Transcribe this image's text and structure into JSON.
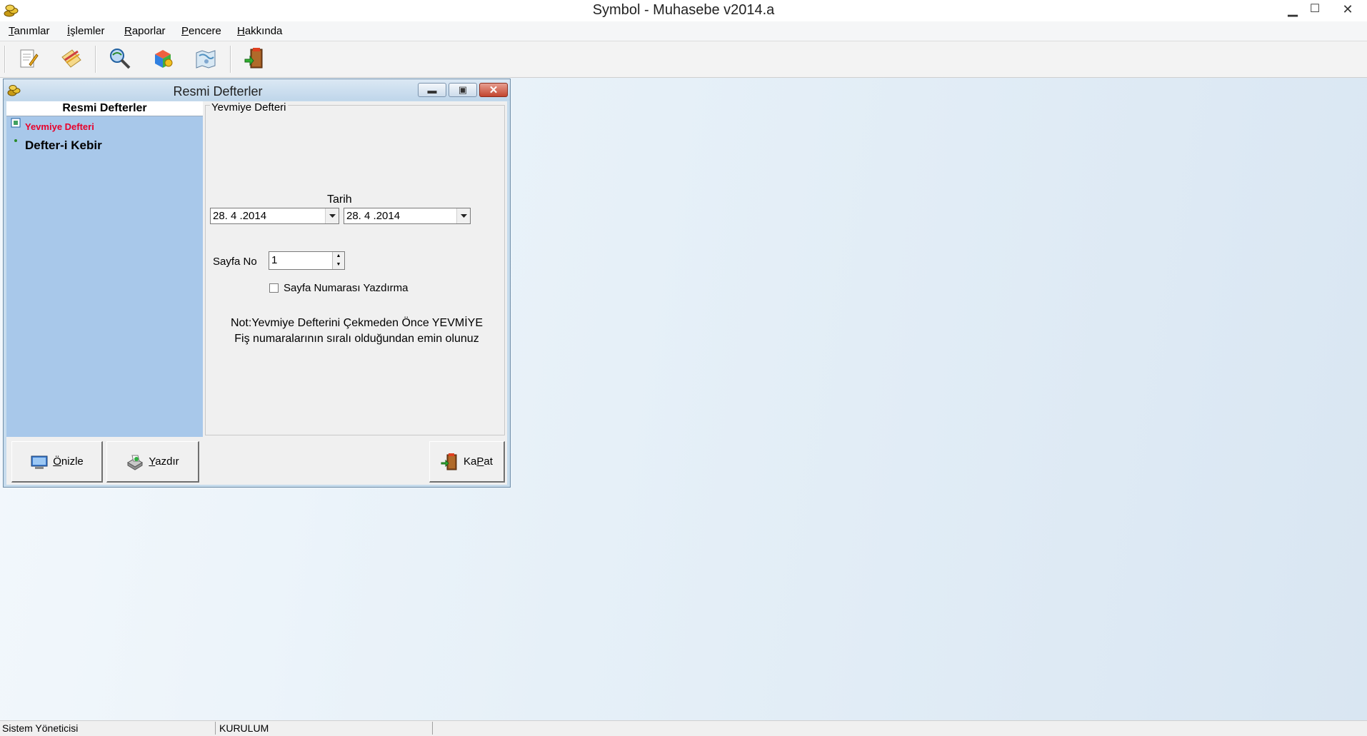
{
  "app": {
    "title": "Symbol - Muhasebe v2014.a",
    "controls": {
      "minimize": "▁",
      "maximize": "☐",
      "close": "✕"
    }
  },
  "menu": [
    "Tanımlar",
    "İşlemler",
    "Raporlar",
    "Pencere",
    "Hakkında"
  ],
  "toolbar": {
    "icons": [
      "edit-document-icon",
      "pencil-paper-icon",
      "search-globe-icon",
      "color-cube-icon",
      "world-map-icon",
      "exit-door-icon"
    ]
  },
  "child_window": {
    "title": "Resmi Defterler",
    "controls": {
      "minimize": "▬",
      "maximize": "▣",
      "close": "✕"
    },
    "tree": {
      "header": "Resmi Defterler",
      "items": [
        {
          "label": "Yevmiye Defteri",
          "selected": true,
          "color": "#e8002a"
        },
        {
          "label": "Defter-i Kebir",
          "selected": false,
          "color": "#000000"
        }
      ]
    },
    "form": {
      "group_title": "Yevmiye Defteri",
      "date_label": "Tarih",
      "date_from": "28. 4 .2014",
      "date_to": "28. 4 .2014",
      "page_no_label": "Sayfa No",
      "page_no_value": "1",
      "no_page_number_label": "Sayfa Numarası Yazdırma",
      "no_page_number_checked": false,
      "note_line1": "Not:Yevmiye Defterini Çekmeden Önce YEVMİYE",
      "note_line2": "Fiş numaralarının sıralı olduğundan emin olunuz"
    },
    "buttons": {
      "preview": {
        "prefix": "",
        "hotkey": "Ö",
        "rest": "nizle"
      },
      "print": {
        "prefix": "",
        "hotkey": "Y",
        "rest": "azdır"
      },
      "close": {
        "prefix": "Ka",
        "hotkey": "P",
        "rest": "at"
      }
    }
  },
  "status": {
    "user": "Sistem Yöneticisi",
    "company": "KURULUM",
    "extra": ""
  },
  "colors": {
    "tree_bg": "#a8c8ea",
    "mdi_bg": "#e6f0f8",
    "selected_item": "#e8002a"
  }
}
